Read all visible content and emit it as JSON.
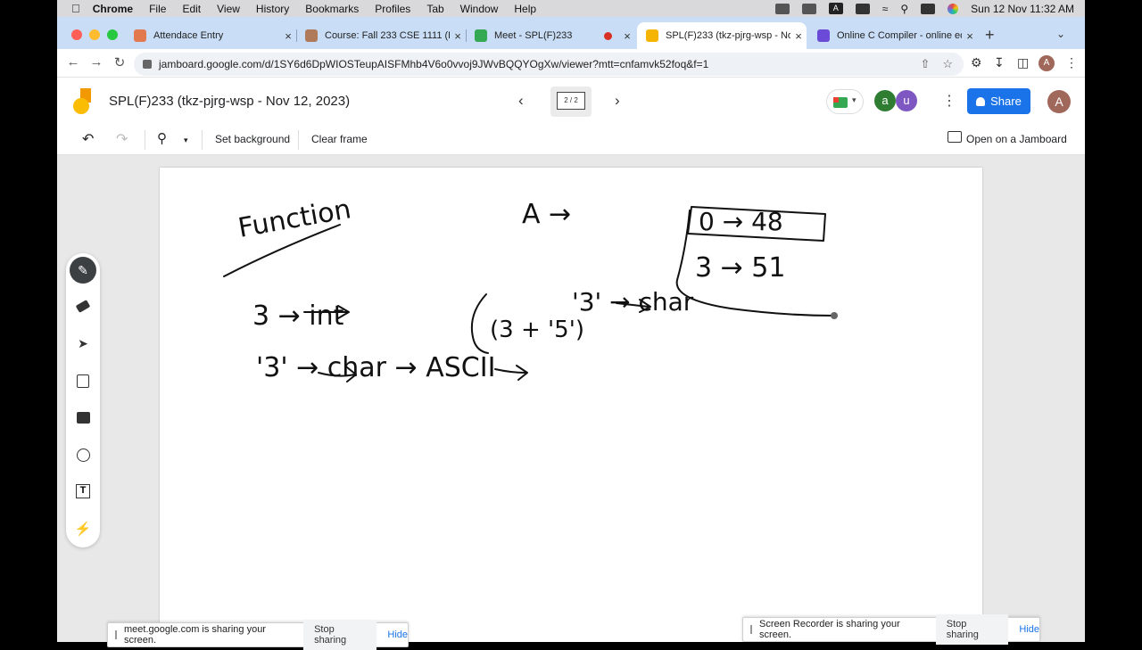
{
  "menubar": {
    "apple": "",
    "items": [
      "Chrome",
      "File",
      "Edit",
      "View",
      "History",
      "Bookmarks",
      "Profiles",
      "Tab",
      "Window",
      "Help"
    ],
    "input_badge": "A",
    "datetime": "Sun 12 Nov  11:32 AM"
  },
  "tabs": [
    {
      "title": "Attendace Entry",
      "color": "#e2794f"
    },
    {
      "title": "Course: Fall 233 CSE 1111 (F)",
      "color": "#b07b5a"
    },
    {
      "title": "Meet - SPL(F)233",
      "color": "#34a853"
    },
    {
      "title": "SPL(F)233 (tkz-pjrg-wsp - No",
      "color": "#f4b400"
    },
    {
      "title": "Online C Compiler - online ed",
      "color": "#6c4ad8"
    }
  ],
  "address": {
    "url": "jamboard.google.com/d/1SY6d6DpWIOSTeupAISFMhb4V6o0vvoj9JWvBQQYOgXw/viewer?mtt=cnfamvk52foq&f=1",
    "profile_initial": "A"
  },
  "jam": {
    "title": "SPL(F)233 (tkz-pjrg-wsp - Nov 12, 2023)",
    "frame_indicator": "2 / 2",
    "participants": [
      {
        "initial": "a",
        "color": "#2e7d32"
      },
      {
        "initial": "u",
        "color": "#7e57c2"
      }
    ],
    "share_label": "Share",
    "user_initial": "A"
  },
  "toolbar": {
    "set_background": "Set background",
    "clear_frame": "Clear frame",
    "open_on_jamboard": "Open on a Jamboard"
  },
  "tools": [
    "pen-tool",
    "eraser-tool",
    "select-tool",
    "sticky-note-tool",
    "image-tool",
    "shape-tool",
    "text-box-tool",
    "laser-tool"
  ],
  "handwriting": {
    "title": "Function",
    "top_mid": "A →",
    "box_top": "0 → 48",
    "box_mid": "3 → 51",
    "line1": "3 → int",
    "line1b": "(3 + '5')",
    "line1c": "'3' → char",
    "line2": "'3' → char → ASCII"
  },
  "sharebars": {
    "meet": {
      "text": "meet.google.com is sharing your screen.",
      "stop": "Stop sharing",
      "hide": "Hide"
    },
    "recorder": {
      "text": "Screen Recorder is sharing your screen.",
      "stop": "Stop sharing",
      "hide": "Hide"
    }
  }
}
